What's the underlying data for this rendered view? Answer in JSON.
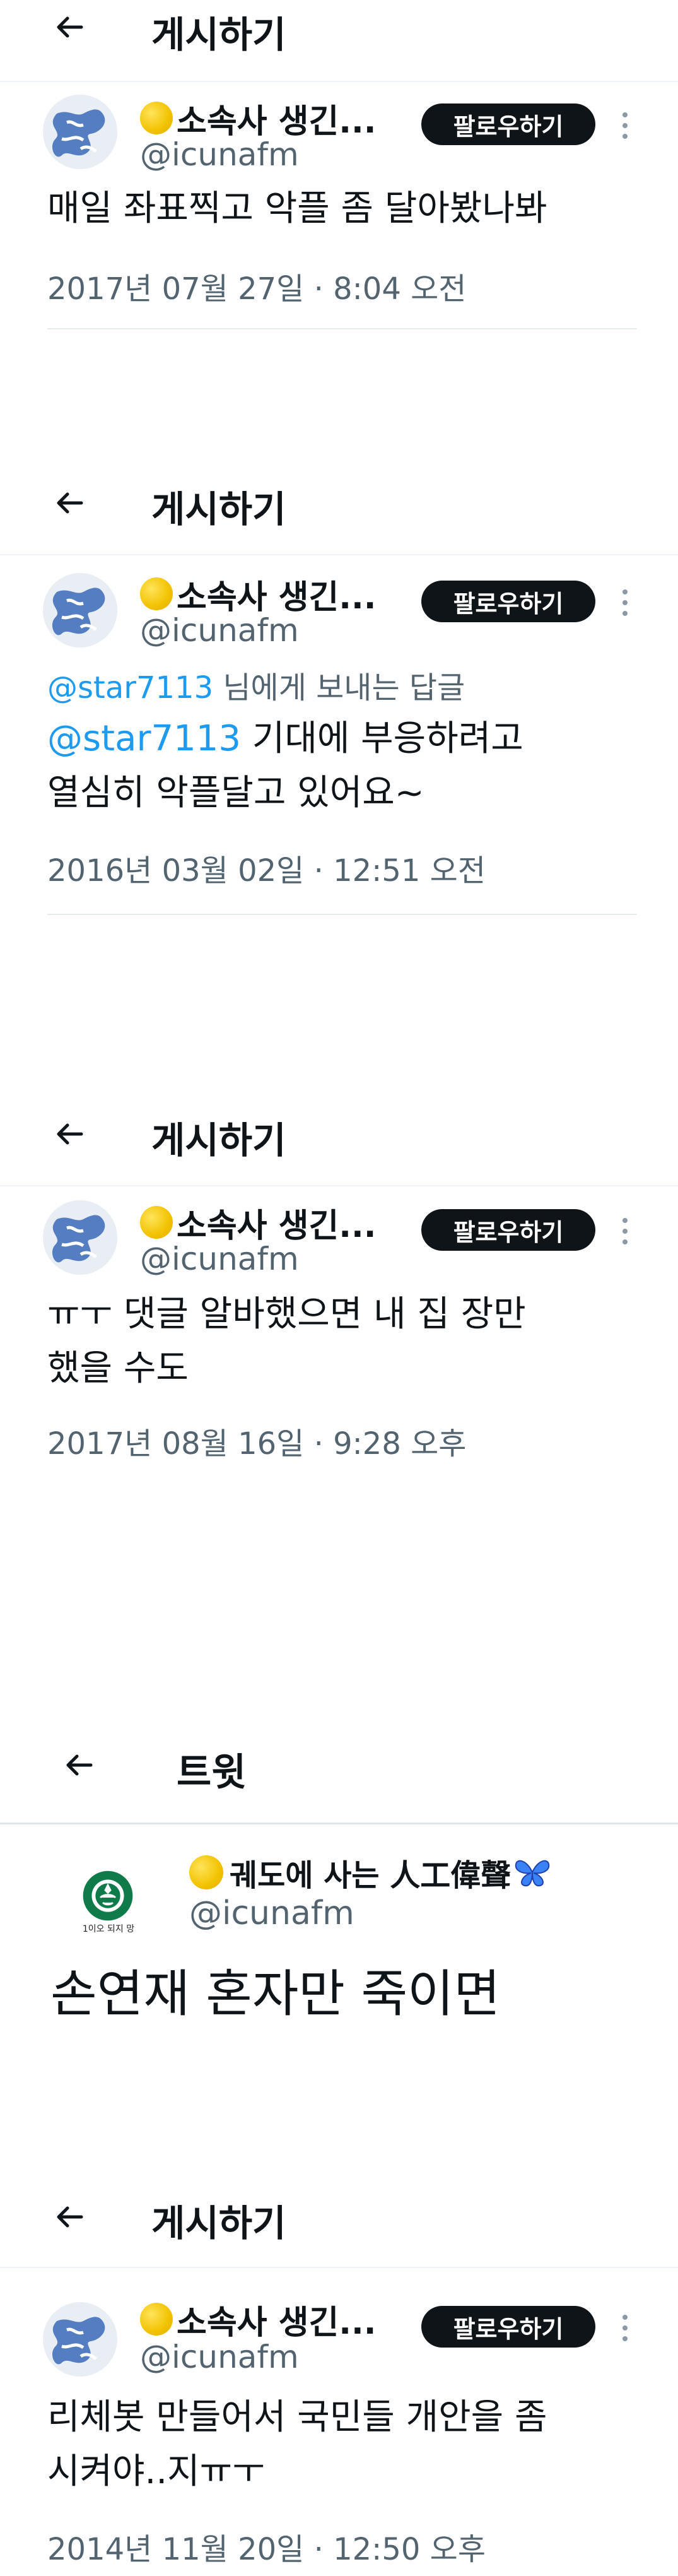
{
  "colors": {
    "accent": "#1d9bf0",
    "text": "#0f1419",
    "muted": "#536471",
    "button": "#0f1419"
  },
  "icons": {
    "back": "arrow-left-icon",
    "more": "more-vertical-icon",
    "coin": "yellow-circle-emoji",
    "butterfly": "butterfly-emoji"
  },
  "posts": [
    {
      "header_title": "게시하기",
      "display_name": "소속사 생긴...",
      "handle": "@icunafm",
      "follow_label": "팔로우하기",
      "text_lines": [
        "매일 좌표찍고 악플 좀 달아봤나봐"
      ],
      "date": "2017년 07월 27일 · 8:04 오전"
    },
    {
      "header_title": "게시하기",
      "display_name": "소속사 생긴...",
      "handle": "@icunafm",
      "follow_label": "팔로우하기",
      "reply_to_mention": "@star7113",
      "reply_to_suffix": " 님에게 보내는 답글",
      "text_mention": "@star7113",
      "text_line1_rest": " 기대에 부응하려고",
      "text_line2": "열심히 악플달고 있어요~",
      "date": "2016년 03월 02일 · 12:51 오전"
    },
    {
      "header_title": "게시하기",
      "display_name": "소속사 생긴...",
      "handle": "@icunafm",
      "follow_label": "팔로우하기",
      "text_lines": [
        "ㅠㅜ 댓글 알바했으면 내 집 장만",
        "했을 수도"
      ],
      "date": "2017년 08월 16일 · 9:28 오후"
    },
    {
      "header_title": "트윗",
      "display_name": "궤도에 사는 人工偉聲",
      "handle": "@icunafm",
      "avatar_caption": "1이오 되지 망",
      "text_lines": [
        "손연재 혼자만 죽이면"
      ]
    },
    {
      "header_title": "게시하기",
      "display_name": "소속사 생긴...",
      "handle": "@icunafm",
      "follow_label": "팔로우하기",
      "text_lines": [
        "리체봇 만들어서 국민들 개안을 좀",
        "시켜야..지ㅠㅜ"
      ],
      "date": "2014년 11월 20일 · 12:50 오후"
    }
  ]
}
